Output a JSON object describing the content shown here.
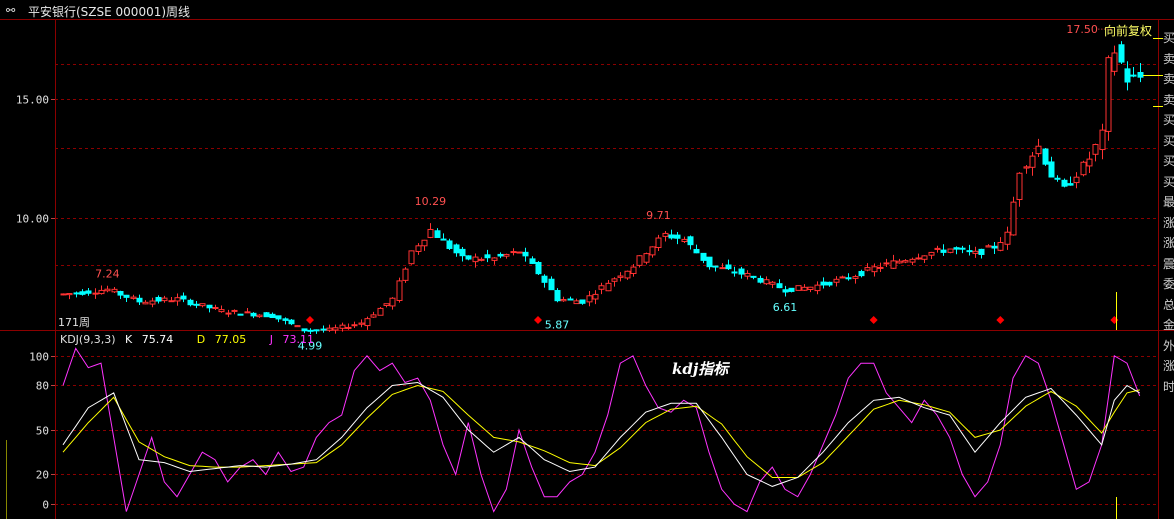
{
  "window": {
    "title": "平安银行(SZSE 000001)周线",
    "period_label": "171周",
    "adjust_label": "向前复权"
  },
  "side_panel": {
    "chars": [
      "买",
      "卖",
      "卖",
      "卖",
      "买",
      "买",
      "买",
      "买",
      "最",
      "涨",
      "涨",
      "震",
      "委",
      "总",
      "金",
      "外",
      "涨",
      "时"
    ]
  },
  "colors": {
    "up": "#ff3232",
    "down": "#00ffff",
    "k_line": "#ffffff",
    "d_line": "#ffff00",
    "j_line": "#ff33ff",
    "grid": "#8b0000",
    "axis": "#8b0000",
    "marker": "#ff0000"
  },
  "chart_data": [
    {
      "type": "candlestick",
      "title": "平安银行(SZSE 000001)周线",
      "yticks": [
        "15.00",
        "10.00"
      ],
      "ylim": [
        5.3,
        18.3
      ],
      "grid": true,
      "annotations": [
        {
          "label": "7.24",
          "x_index": 7,
          "value": 7.24
        },
        {
          "label": "4.99",
          "x_index": 39,
          "value": 4.99
        },
        {
          "label": "10.29",
          "x_index": 58,
          "value": 10.29
        },
        {
          "label": "5.87",
          "x_index": 78,
          "value": 5.87
        },
        {
          "label": "9.71",
          "x_index": 94,
          "value": 9.71
        },
        {
          "label": "6.61",
          "x_index": 114,
          "value": 6.61
        },
        {
          "label": "17.50",
          "x_index": 166,
          "value": 17.5
        }
      ],
      "markers_x_index": [
        39,
        75,
        128,
        148,
        166
      ],
      "anchors": [
        [
          0,
          6.8
        ],
        [
          7,
          7.0
        ],
        [
          12,
          6.5
        ],
        [
          18,
          6.6
        ],
        [
          25,
          6.1
        ],
        [
          33,
          5.9
        ],
        [
          38,
          5.3
        ],
        [
          42,
          5.3
        ],
        [
          47,
          5.6
        ],
        [
          52,
          6.6
        ],
        [
          55,
          8.6
        ],
        [
          58,
          9.5
        ],
        [
          63,
          8.3
        ],
        [
          68,
          8.3
        ],
        [
          72,
          8.6
        ],
        [
          75,
          7.7
        ],
        [
          78,
          6.6
        ],
        [
          82,
          6.5
        ],
        [
          86,
          7.3
        ],
        [
          90,
          8.0
        ],
        [
          92,
          8.6
        ],
        [
          95,
          9.3
        ],
        [
          98,
          9.1
        ],
        [
          102,
          8.0
        ],
        [
          108,
          7.6
        ],
        [
          114,
          7.0
        ],
        [
          118,
          7.1
        ],
        [
          124,
          7.5
        ],
        [
          128,
          7.9
        ],
        [
          132,
          8.2
        ],
        [
          136,
          8.5
        ],
        [
          140,
          8.7
        ],
        [
          144,
          8.5
        ],
        [
          147,
          8.8
        ],
        [
          149,
          9.3
        ],
        [
          151,
          12.0
        ],
        [
          154,
          13.0
        ],
        [
          156,
          11.8
        ],
        [
          158,
          11.2
        ],
        [
          162,
          12.5
        ],
        [
          164,
          13.5
        ],
        [
          165,
          16.5
        ],
        [
          166,
          17.0
        ],
        [
          167,
          16.5
        ],
        [
          168,
          15.8
        ],
        [
          170,
          15.9
        ]
      ]
    },
    {
      "type": "line",
      "title": "KDJ(9,3,3)",
      "series": [
        {
          "name": "K",
          "last": "75.74"
        },
        {
          "name": "D",
          "last": "77.05"
        },
        {
          "name": "J",
          "last": "73.11"
        }
      ],
      "yticks": [
        100,
        80,
        50,
        20,
        0
      ],
      "ylim": [
        -10,
        112
      ],
      "k_anchors": [
        [
          0,
          40
        ],
        [
          4,
          65
        ],
        [
          8,
          75
        ],
        [
          12,
          30
        ],
        [
          16,
          28
        ],
        [
          20,
          22
        ],
        [
          24,
          24
        ],
        [
          28,
          26
        ],
        [
          32,
          25
        ],
        [
          36,
          27
        ],
        [
          40,
          30
        ],
        [
          44,
          45
        ],
        [
          48,
          65
        ],
        [
          52,
          80
        ],
        [
          56,
          82
        ],
        [
          60,
          72
        ],
        [
          64,
          50
        ],
        [
          68,
          35
        ],
        [
          72,
          45
        ],
        [
          76,
          30
        ],
        [
          80,
          22
        ],
        [
          84,
          25
        ],
        [
          88,
          45
        ],
        [
          92,
          62
        ],
        [
          96,
          68
        ],
        [
          100,
          68
        ],
        [
          104,
          45
        ],
        [
          108,
          20
        ],
        [
          112,
          12
        ],
        [
          116,
          18
        ],
        [
          120,
          35
        ],
        [
          124,
          55
        ],
        [
          128,
          70
        ],
        [
          132,
          72
        ],
        [
          136,
          65
        ],
        [
          140,
          60
        ],
        [
          144,
          35
        ],
        [
          148,
          55
        ],
        [
          152,
          72
        ],
        [
          156,
          78
        ],
        [
          160,
          60
        ],
        [
          164,
          40
        ],
        [
          166,
          70
        ],
        [
          168,
          80
        ],
        [
          170,
          75
        ]
      ],
      "d_anchors": [
        [
          0,
          35
        ],
        [
          4,
          55
        ],
        [
          8,
          72
        ],
        [
          12,
          42
        ],
        [
          16,
          32
        ],
        [
          20,
          26
        ],
        [
          24,
          25
        ],
        [
          28,
          25
        ],
        [
          32,
          26
        ],
        [
          36,
          27
        ],
        [
          40,
          28
        ],
        [
          44,
          40
        ],
        [
          48,
          58
        ],
        [
          52,
          74
        ],
        [
          56,
          80
        ],
        [
          60,
          76
        ],
        [
          64,
          60
        ],
        [
          68,
          45
        ],
        [
          72,
          42
        ],
        [
          76,
          36
        ],
        [
          80,
          28
        ],
        [
          84,
          26
        ],
        [
          88,
          38
        ],
        [
          92,
          55
        ],
        [
          96,
          64
        ],
        [
          100,
          66
        ],
        [
          104,
          54
        ],
        [
          108,
          32
        ],
        [
          112,
          18
        ],
        [
          116,
          18
        ],
        [
          120,
          28
        ],
        [
          124,
          46
        ],
        [
          128,
          64
        ],
        [
          132,
          70
        ],
        [
          136,
          67
        ],
        [
          140,
          62
        ],
        [
          144,
          45
        ],
        [
          148,
          50
        ],
        [
          152,
          66
        ],
        [
          156,
          76
        ],
        [
          160,
          66
        ],
        [
          164,
          48
        ],
        [
          166,
          62
        ],
        [
          168,
          75
        ],
        [
          170,
          77
        ]
      ],
      "j_anchors": [
        [
          0,
          80
        ],
        [
          2,
          105
        ],
        [
          4,
          92
        ],
        [
          6,
          95
        ],
        [
          8,
          45
        ],
        [
          10,
          -5
        ],
        [
          12,
          20
        ],
        [
          14,
          45
        ],
        [
          16,
          15
        ],
        [
          18,
          5
        ],
        [
          20,
          20
        ],
        [
          22,
          35
        ],
        [
          24,
          30
        ],
        [
          26,
          15
        ],
        [
          28,
          25
        ],
        [
          30,
          30
        ],
        [
          32,
          20
        ],
        [
          34,
          35
        ],
        [
          36,
          22
        ],
        [
          38,
          25
        ],
        [
          40,
          45
        ],
        [
          42,
          55
        ],
        [
          44,
          60
        ],
        [
          46,
          90
        ],
        [
          48,
          100
        ],
        [
          50,
          90
        ],
        [
          52,
          95
        ],
        [
          54,
          82
        ],
        [
          56,
          85
        ],
        [
          58,
          70
        ],
        [
          60,
          40
        ],
        [
          62,
          20
        ],
        [
          64,
          55
        ],
        [
          66,
          20
        ],
        [
          68,
          -5
        ],
        [
          70,
          10
        ],
        [
          72,
          50
        ],
        [
          74,
          25
        ],
        [
          76,
          5
        ],
        [
          78,
          5
        ],
        [
          80,
          15
        ],
        [
          82,
          20
        ],
        [
          84,
          35
        ],
        [
          86,
          60
        ],
        [
          88,
          95
        ],
        [
          90,
          100
        ],
        [
          92,
          80
        ],
        [
          94,
          65
        ],
        [
          96,
          62
        ],
        [
          98,
          70
        ],
        [
          100,
          65
        ],
        [
          102,
          35
        ],
        [
          104,
          10
        ],
        [
          106,
          0
        ],
        [
          108,
          -5
        ],
        [
          110,
          15
        ],
        [
          112,
          25
        ],
        [
          114,
          10
        ],
        [
          116,
          5
        ],
        [
          118,
          20
        ],
        [
          120,
          40
        ],
        [
          122,
          60
        ],
        [
          124,
          85
        ],
        [
          126,
          95
        ],
        [
          128,
          95
        ],
        [
          130,
          75
        ],
        [
          132,
          65
        ],
        [
          134,
          55
        ],
        [
          136,
          70
        ],
        [
          138,
          60
        ],
        [
          140,
          45
        ],
        [
          142,
          20
        ],
        [
          144,
          5
        ],
        [
          146,
          15
        ],
        [
          148,
          40
        ],
        [
          150,
          85
        ],
        [
          152,
          100
        ],
        [
          154,
          95
        ],
        [
          156,
          70
        ],
        [
          158,
          40
        ],
        [
          160,
          10
        ],
        [
          162,
          15
        ],
        [
          164,
          40
        ],
        [
          166,
          100
        ],
        [
          168,
          95
        ],
        [
          170,
          73
        ]
      ]
    }
  ]
}
